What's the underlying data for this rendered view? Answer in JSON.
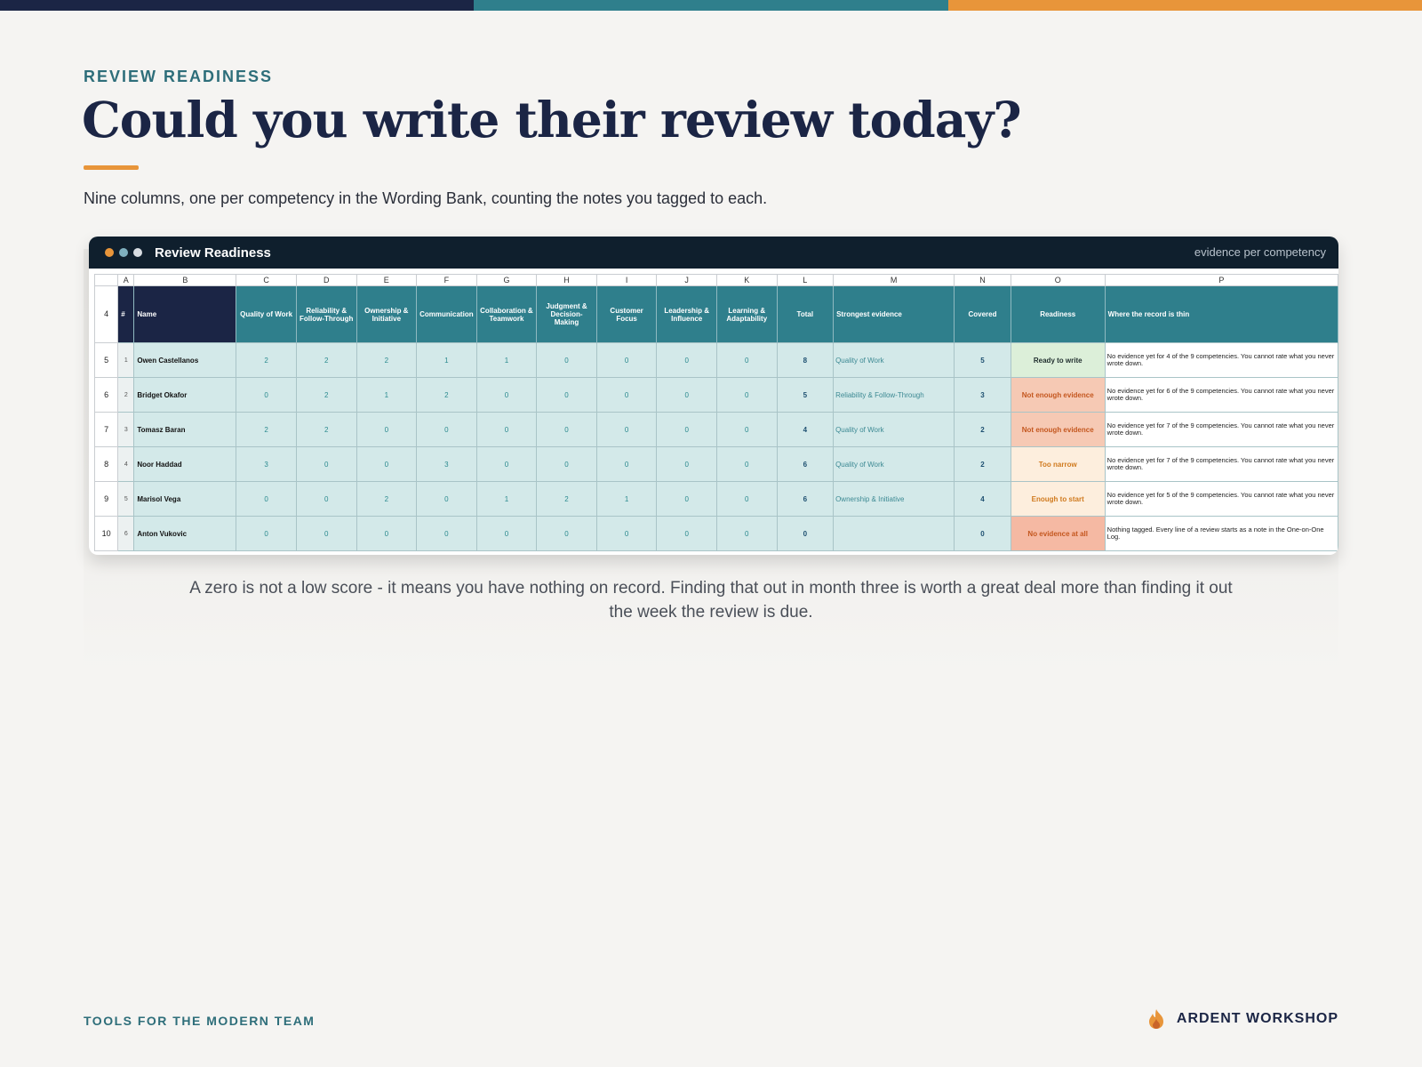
{
  "page": {
    "eyebrow": "REVIEW READINESS",
    "title": "Could you write their review today?",
    "subtitle": "Nine columns, one per competency in the Wording Bank, counting the notes you tagged to each.",
    "caption": "A zero is not a low score - it means you have nothing on record. Finding that out in month three is worth a great deal more than finding it out the week the review is due.",
    "footer_left": "TOOLS FOR THE MODERN TEAM",
    "footer_brand": "ARDENT WORKSHOP",
    "brand_icon": "flame-icon"
  },
  "colors": {
    "navy": "#1b2545",
    "teal": "#2f7f8c",
    "orange": "#e8953a",
    "ready": "#dcefd9",
    "not_enough": "#f6c9b4",
    "too_narrow": "#fdeedd",
    "none": "#f5b9a3"
  },
  "window": {
    "title": "Review Readiness",
    "note": "evidence per competency",
    "dots": [
      "#e8953a",
      "#7fb0bf",
      "#d8dde2"
    ]
  },
  "sheet": {
    "column_letters": [
      "A",
      "B",
      "C",
      "D",
      "E",
      "F",
      "G",
      "H",
      "I",
      "J",
      "K",
      "L",
      "M",
      "N",
      "O",
      "P"
    ],
    "header_row_number": "4",
    "headers": [
      "#",
      "Name",
      "Quality of Work",
      "Reliability & Follow-Through",
      "Ownership & Initiative",
      "Communication",
      "Collaboration & Teamwork",
      "Judgment & Decision-Making",
      "Customer Focus",
      "Leadership & Influence",
      "Learning & Adaptability",
      "Total",
      "Strongest evidence",
      "Covered",
      "Readiness",
      "Where the record is thin"
    ],
    "rows": [
      {
        "row": "5",
        "num": "1",
        "name": "Owen Castellanos",
        "scores": [
          "2",
          "2",
          "2",
          "1",
          "1",
          "0",
          "0",
          "0",
          "0"
        ],
        "total": "8",
        "strongest": "Quality of Work",
        "covered": "5",
        "readiness": "Ready to write",
        "status": "ready",
        "thin": "No evidence yet for 4 of the 9 competencies. You cannot rate what you never wrote down."
      },
      {
        "row": "6",
        "num": "2",
        "name": "Bridget Okafor",
        "scores": [
          "0",
          "2",
          "1",
          "2",
          "0",
          "0",
          "0",
          "0",
          "0"
        ],
        "total": "5",
        "strongest": "Reliability & Follow-Through",
        "covered": "3",
        "readiness": "Not enough evidence",
        "status": "not_enough",
        "thin": "No evidence yet for 6 of the 9 competencies. You cannot rate what you never wrote down."
      },
      {
        "row": "7",
        "num": "3",
        "name": "Tomasz Baran",
        "scores": [
          "2",
          "2",
          "0",
          "0",
          "0",
          "0",
          "0",
          "0",
          "0"
        ],
        "total": "4",
        "strongest": "Quality of Work",
        "covered": "2",
        "readiness": "Not enough evidence",
        "status": "not_enough",
        "thin": "No evidence yet for 7 of the 9 competencies. You cannot rate what you never wrote down."
      },
      {
        "row": "8",
        "num": "4",
        "name": "Noor Haddad",
        "scores": [
          "3",
          "0",
          "0",
          "3",
          "0",
          "0",
          "0",
          "0",
          "0"
        ],
        "total": "6",
        "strongest": "Quality of Work",
        "covered": "2",
        "readiness": "Too narrow",
        "status": "too_narrow",
        "thin": "No evidence yet for 7 of the 9 competencies. You cannot rate what you never wrote down."
      },
      {
        "row": "9",
        "num": "5",
        "name": "Marisol Vega",
        "scores": [
          "0",
          "0",
          "2",
          "0",
          "1",
          "2",
          "1",
          "0",
          "0"
        ],
        "total": "6",
        "strongest": "Ownership & Initiative",
        "covered": "4",
        "readiness": "Enough to start",
        "status": "too_narrow",
        "thin": "No evidence yet for 5 of the 9 competencies. You cannot rate what you never wrote down."
      },
      {
        "row": "10",
        "num": "6",
        "name": "Anton Vukovic",
        "scores": [
          "0",
          "0",
          "0",
          "0",
          "0",
          "0",
          "0",
          "0",
          "0"
        ],
        "total": "0",
        "strongest": "",
        "covered": "0",
        "readiness": "No evidence at all",
        "status": "none",
        "thin": "Nothing tagged. Every line of a review starts as a note in the One-on-One Log."
      }
    ]
  }
}
